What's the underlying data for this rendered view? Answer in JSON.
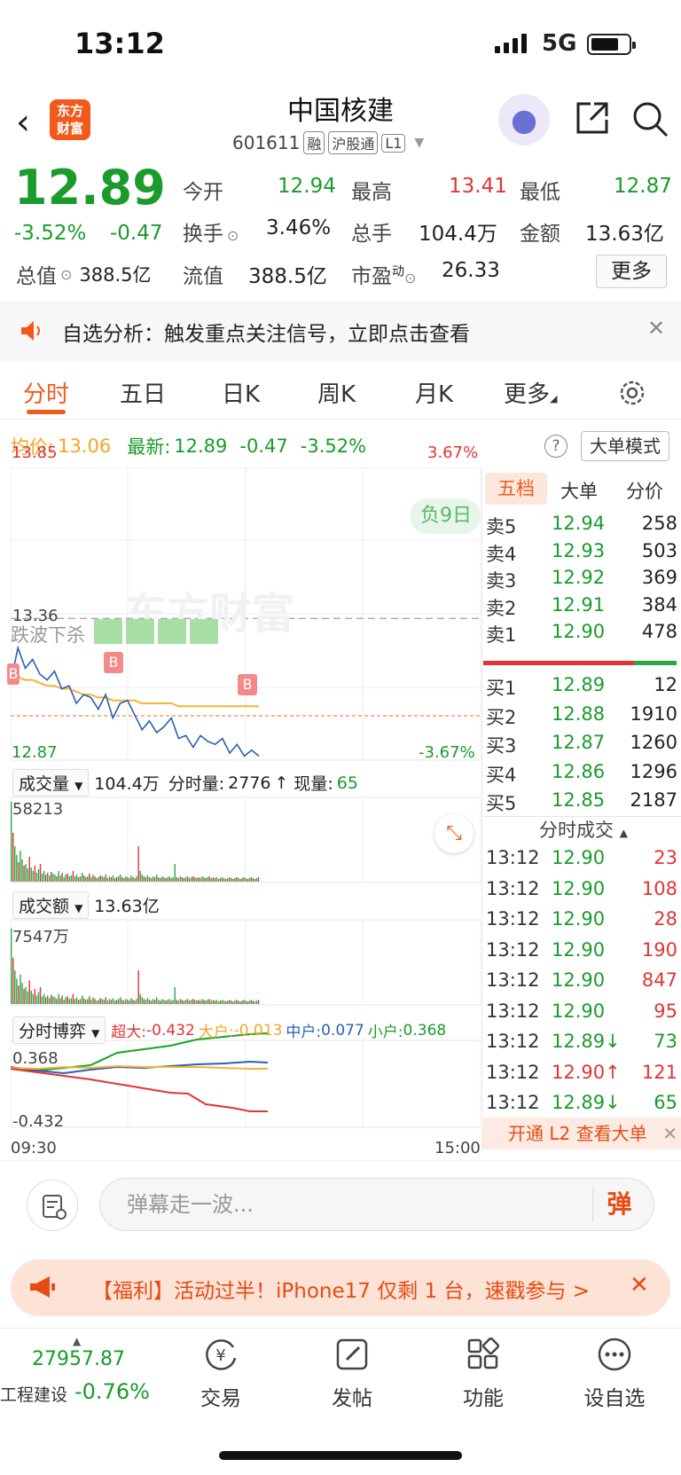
{
  "status_bar": {
    "time": "13:12",
    "network": "5G"
  },
  "header": {
    "logo_line1": "东方",
    "logo_line2": "财富",
    "stock_name": "中国核建",
    "stock_code": "601611",
    "tags": [
      "融",
      "沪股通",
      "L1"
    ]
  },
  "quote": {
    "price": "12.89",
    "change_pct": "-3.52%",
    "change_amt": "-0.47",
    "market_cap_label": "总值",
    "market_cap_value": "388.5亿",
    "stats": [
      {
        "label": "今开",
        "value": "12.94",
        "color": "green"
      },
      {
        "label": "最高",
        "value": "13.41",
        "color": "red"
      },
      {
        "label": "最低",
        "value": "12.87",
        "color": "green"
      },
      {
        "label": "换手",
        "value": "3.46%",
        "color": "black"
      },
      {
        "label": "总手",
        "value": "104.4万",
        "color": "black"
      },
      {
        "label": "金额",
        "value": "13.63亿",
        "color": "black"
      },
      {
        "label": "流值",
        "value": "388.5亿",
        "color": "black"
      },
      {
        "label": "市盈",
        "value": "26.33",
        "color": "black"
      },
      {
        "label": "动",
        "value": "",
        "color": "black"
      }
    ],
    "more_label": "更多"
  },
  "alert": {
    "text": "自选分析：触发重点关注信号，立即点击查看"
  },
  "tabs": [
    "分时",
    "五日",
    "日K",
    "周K",
    "月K",
    "更多"
  ],
  "avg_bar": {
    "avg_label": "均价:",
    "avg_value": "13.06",
    "latest_label": "最新:",
    "latest_value": "12.89",
    "chg": "-0.47",
    "pct": "-3.52%",
    "help": "?",
    "mode_btn": "大单模式"
  },
  "chart": {
    "top_price": "13.85",
    "top_pct": "3.67%",
    "bottom_price": "12.87",
    "bottom_pct": "-3.67%",
    "prev_close_label": "13.36",
    "neg_days_badge": "负9日",
    "watermark": "东方财富",
    "signal_text": "跌波下杀",
    "b_marker": "B",
    "volume_selector": "成交量",
    "volume_total": "104.4万",
    "minute_vol_label": "分时量:",
    "minute_vol": "2776",
    "now_vol_label": "现量:",
    "now_vol": "65",
    "volume_max": "58213",
    "amount_selector": "成交额",
    "amount_total": "13.63亿",
    "amount_max": "7547万",
    "game_selector": "分时博弈",
    "super_label": "超大:",
    "super_value": "-0.432",
    "big_label": "大户:",
    "big_value": "-0.013",
    "mid_label": "中户:",
    "mid_value": "0.077",
    "small_label": "小户:",
    "small_value": "0.368",
    "game_top": "0.368",
    "game_bottom": "-0.432",
    "time_start": "09:30",
    "time_end": "15:00"
  },
  "chart_data": {
    "type": "line",
    "title": "",
    "ylim": [
      12.87,
      13.85
    ],
    "prev_close": 13.36,
    "series": [
      {
        "name": "最新",
        "color": "#2b5fb3",
        "values": [
          13.14,
          13.26,
          13.19,
          13.22,
          13.17,
          13.15,
          13.18,
          13.12,
          13.13,
          13.07,
          13.1,
          13.09,
          13.05,
          13.1,
          13.02,
          13.07,
          13.08,
          13.03,
          12.98,
          13.01,
          12.97,
          12.99,
          13.02,
          12.95,
          12.96,
          12.92,
          12.96,
          12.94,
          12.93,
          12.95,
          12.9,
          12.93,
          12.89,
          12.91,
          12.89
        ]
      },
      {
        "name": "均价",
        "color": "#f5b336",
        "values": [
          13.14,
          13.16,
          13.15,
          13.15,
          13.14,
          13.13,
          13.13,
          13.12,
          13.12,
          13.11,
          13.1,
          13.1,
          13.09,
          13.09,
          13.08,
          13.08,
          13.08,
          13.08,
          13.07,
          13.07,
          13.07,
          13.07,
          13.07,
          13.06,
          13.06,
          13.06,
          13.06,
          13.06,
          13.06,
          13.06,
          13.06,
          13.06,
          13.06,
          13.06,
          13.06
        ]
      }
    ],
    "x_labels": [
      "09:30",
      "15:00"
    ]
  },
  "order_book": {
    "tabs": [
      "五档",
      "大单",
      "分价"
    ],
    "asks": [
      {
        "label": "卖5",
        "price": "12.94",
        "vol": "258"
      },
      {
        "label": "卖4",
        "price": "12.93",
        "vol": "503"
      },
      {
        "label": "卖3",
        "price": "12.92",
        "vol": "369"
      },
      {
        "label": "卖2",
        "price": "12.91",
        "vol": "384"
      },
      {
        "label": "卖1",
        "price": "12.90",
        "vol": "478"
      }
    ],
    "bids": [
      {
        "label": "买1",
        "price": "12.89",
        "vol": "12"
      },
      {
        "label": "买2",
        "price": "12.88",
        "vol": "1910"
      },
      {
        "label": "买3",
        "price": "12.87",
        "vol": "1260"
      },
      {
        "label": "买4",
        "price": "12.86",
        "vol": "1296"
      },
      {
        "label": "买5",
        "price": "12.85",
        "vol": "2187"
      }
    ],
    "ticks_title": "分时成交",
    "ticks": [
      {
        "t": "13:12",
        "p": "12.90",
        "v": "23",
        "vc": "red"
      },
      {
        "t": "13:12",
        "p": "12.90",
        "v": "108",
        "vc": "red"
      },
      {
        "t": "13:12",
        "p": "12.90",
        "v": "28",
        "vc": "red"
      },
      {
        "t": "13:12",
        "p": "12.90",
        "v": "190",
        "vc": "red"
      },
      {
        "t": "13:12",
        "p": "12.90",
        "v": "847",
        "vc": "red"
      },
      {
        "t": "13:12",
        "p": "12.90",
        "v": "95",
        "vc": "red"
      },
      {
        "t": "13:12",
        "p": "12.89↓",
        "v": "73",
        "vc": "green"
      },
      {
        "t": "13:12",
        "p": "12.90↑",
        "v": "121",
        "vc": "red"
      },
      {
        "t": "13:12",
        "p": "12.89↓",
        "v": "65",
        "vc": "green"
      }
    ],
    "l2_text": "开通 L2 查看大单"
  },
  "comment_bar": {
    "placeholder": "弹幕走一波...",
    "danmu": "弹"
  },
  "promo": {
    "text": "【福利】活动过半！iPhone17 仅剩 1 台，速戳参与 >"
  },
  "bottom_nav": {
    "index_value": "27957.87",
    "index_name": "工程建设",
    "index_change": "-0.76%",
    "items": [
      "交易",
      "发帖",
      "功能",
      "设自选"
    ]
  }
}
